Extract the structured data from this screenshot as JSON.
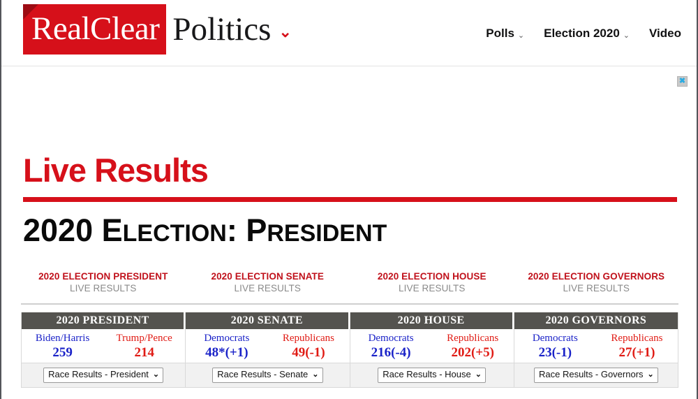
{
  "header": {
    "logo": {
      "primary": "RealClear",
      "secondary": "Politics",
      "caret": "⌄"
    },
    "nav": [
      {
        "label": "Polls",
        "caret": "⌄",
        "has_caret": true
      },
      {
        "label": "Election 2020",
        "caret": "⌄",
        "has_caret": true
      },
      {
        "label": "Video",
        "caret": "",
        "has_caret": false
      }
    ]
  },
  "ad": {
    "close_label": "✖"
  },
  "hero": {
    "live_results": "Live Results",
    "title_lead": "2020 E",
    "title_rest_1": "LECTION",
    "title_colon": ": P",
    "title_rest_2": "RESIDENT",
    "title_full": "2020 ELECTION: PRESIDENT"
  },
  "quick_links": [
    {
      "title": "2020 ELECTION PRESIDENT",
      "subtitle": "LIVE RESULTS"
    },
    {
      "title": "2020 ELECTION SENATE",
      "subtitle": "LIVE RESULTS"
    },
    {
      "title": "2020 ELECTION HOUSE",
      "subtitle": "LIVE RESULTS"
    },
    {
      "title": "2020 ELECTION GOVERNORS",
      "subtitle": "LIVE RESULTS"
    }
  ],
  "results": {
    "columns": [
      {
        "header": "2020 PRESIDENT",
        "left": {
          "name": "Biden/Harris",
          "value": "259"
        },
        "right": {
          "name": "Trump/Pence",
          "value": "214"
        },
        "select": {
          "value": "Race Results - President",
          "caret": "⌄"
        }
      },
      {
        "header": "2020 SENATE",
        "left": {
          "name": "Democrats",
          "value": "48*(+1)"
        },
        "right": {
          "name": "Republicans",
          "value": "49(-1)"
        },
        "select": {
          "value": "Race Results - Senate",
          "caret": "⌄"
        }
      },
      {
        "header": "2020 HOUSE",
        "left": {
          "name": "Democrats",
          "value": "216(-4)"
        },
        "right": {
          "name": "Republicans",
          "value": "202(+5)"
        },
        "select": {
          "value": "Race Results - House",
          "caret": "⌄"
        }
      },
      {
        "header": "2020 GOVERNORS",
        "left": {
          "name": "Democrats",
          "value": "23(-1)"
        },
        "right": {
          "name": "Republicans",
          "value": "27(+1)"
        },
        "select": {
          "value": "Race Results - Governors",
          "caret": "⌄"
        }
      }
    ]
  },
  "colors": {
    "brand_red": "#d6101a",
    "democrat_blue": "#1a22c8",
    "republican_red": "#e01b14",
    "header_gray": "#54534f",
    "link_red": "#c0111b",
    "muted_gray": "#8a8a8a"
  }
}
